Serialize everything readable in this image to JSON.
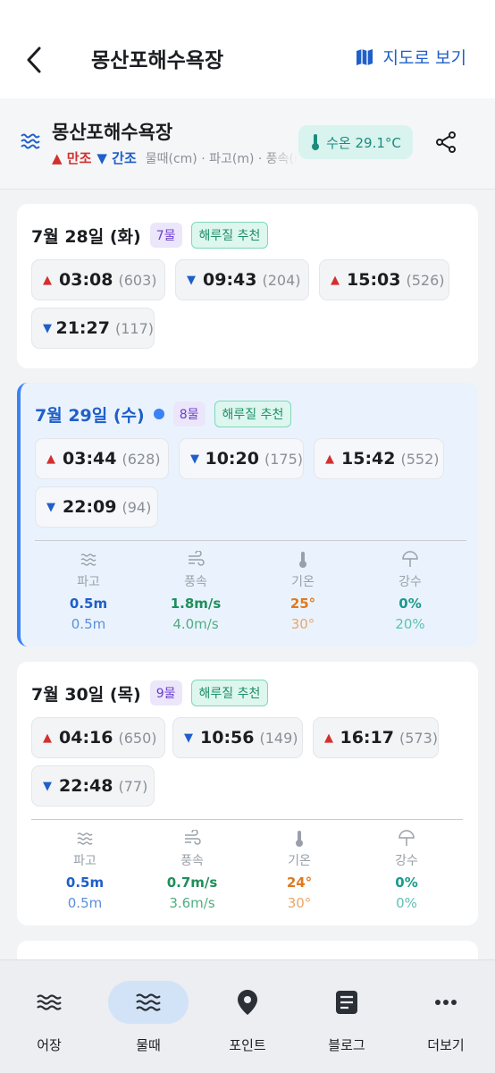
{
  "header": {
    "title": "몽산포해수욕장",
    "map_link": "지도로 보기"
  },
  "location": {
    "name": "몽산포해수욕장",
    "legend_high": "만조",
    "legend_low": "간조",
    "legend_extra": "물때(cm) · 파고(m) · 풍속(m/s)",
    "water_temp": "수온 29.1°C"
  },
  "days": [
    {
      "title": "7월 28일 (화)",
      "mul": "7물",
      "rec": "해루질 추천",
      "today": false,
      "tides": [
        {
          "dir": "up",
          "time": "03:08",
          "height": "(603)"
        },
        {
          "dir": "down",
          "time": "09:43",
          "height": "(204)"
        },
        {
          "dir": "up",
          "time": "15:03",
          "height": "(526)"
        },
        {
          "dir": "down",
          "time": "21:27",
          "height": "(117)"
        }
      ]
    },
    {
      "title": "7월 29일 (수)",
      "mul": "8물",
      "rec": "해루질 추천",
      "today": true,
      "tides": [
        {
          "dir": "up",
          "time": "03:44",
          "height": "(628)"
        },
        {
          "dir": "down",
          "time": "10:20",
          "height": "(175)"
        },
        {
          "dir": "up",
          "time": "15:42",
          "height": "(552)"
        },
        {
          "dir": "down",
          "time": "22:09",
          "height": "(94)"
        }
      ],
      "weather": {
        "wave": {
          "label": "파고",
          "v1": "0.5m",
          "v2": "0.5m"
        },
        "wind": {
          "label": "풍속",
          "v1": "1.8m/s",
          "v2": "4.0m/s"
        },
        "temp": {
          "label": "기온",
          "v1": "25°",
          "v2": "30°"
        },
        "rain": {
          "label": "강수",
          "v1": "0%",
          "v2": "20%"
        }
      }
    },
    {
      "title": "7월 30일 (목)",
      "mul": "9물",
      "rec": "해루질 추천",
      "today": false,
      "tides": [
        {
          "dir": "up",
          "time": "04:16",
          "height": "(650)"
        },
        {
          "dir": "down",
          "time": "10:56",
          "height": "(149)"
        },
        {
          "dir": "up",
          "time": "16:17",
          "height": "(573)"
        },
        {
          "dir": "down",
          "time": "22:48",
          "height": "(77)"
        }
      ],
      "weather": {
        "wave": {
          "label": "파고",
          "v1": "0.5m",
          "v2": "0.5m"
        },
        "wind": {
          "label": "풍속",
          "v1": "0.7m/s",
          "v2": "3.6m/s"
        },
        "temp": {
          "label": "기온",
          "v1": "24°",
          "v2": "30°"
        },
        "rain": {
          "label": "강수",
          "v1": "0%",
          "v2": "0%"
        }
      }
    }
  ],
  "nav": [
    {
      "label": "어장",
      "icon": "waves-icon"
    },
    {
      "label": "물때",
      "icon": "tide-waves-icon",
      "active": true
    },
    {
      "label": "포인트",
      "icon": "location-pin-icon"
    },
    {
      "label": "블로그",
      "icon": "blog-document-icon"
    },
    {
      "label": "더보기",
      "icon": "more-dots-icon"
    }
  ],
  "colors": {
    "accent": "#1f5fc9",
    "high_tide": "#d32f2f",
    "low_tide": "#1f5fc9",
    "water_temp": "#1a8c7e"
  }
}
